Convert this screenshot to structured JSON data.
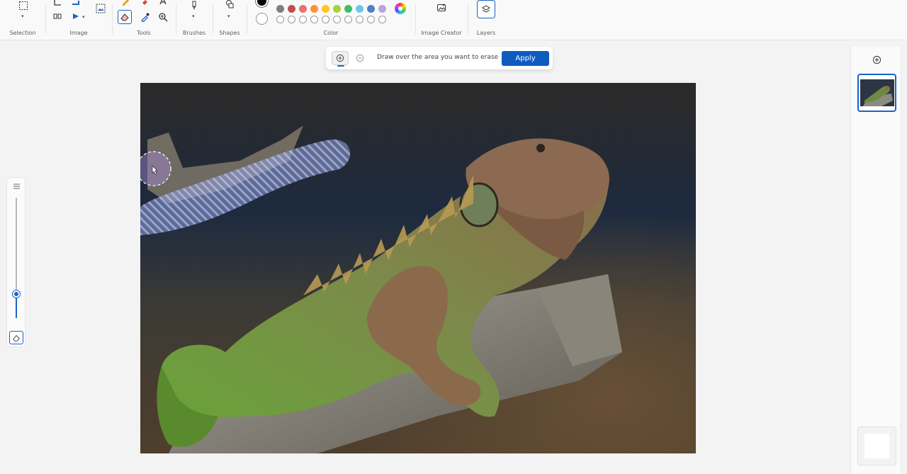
{
  "ribbon": {
    "groups": {
      "selection": "Selection",
      "image": "Image",
      "tools": "Tools",
      "brushes": "Brushes",
      "shapes": "Shapes",
      "color": "Color",
      "image_creator": "Image Creator",
      "layers": "Layers"
    },
    "colors": {
      "primary": "#000000",
      "secondary": "#ffffff",
      "palette_row1": [
        "#7f7f7f",
        "#c0504d",
        "#e8736f",
        "#ff8f3b",
        "#ffc71a",
        "#a8d23a",
        "#3dbd6b",
        "#6ac8e8",
        "#4f7ec8",
        "#b9a4e0"
      ],
      "palette_row2_empty_count": 10
    }
  },
  "erase_toolbar": {
    "hint": "Draw over the area you want to erase",
    "apply_label": "Apply"
  },
  "brush_size": {
    "level": 0.2
  },
  "layers_panel": {
    "selected_layer_icon": "image-layer-icon"
  },
  "accent_color": "#1a63c8"
}
